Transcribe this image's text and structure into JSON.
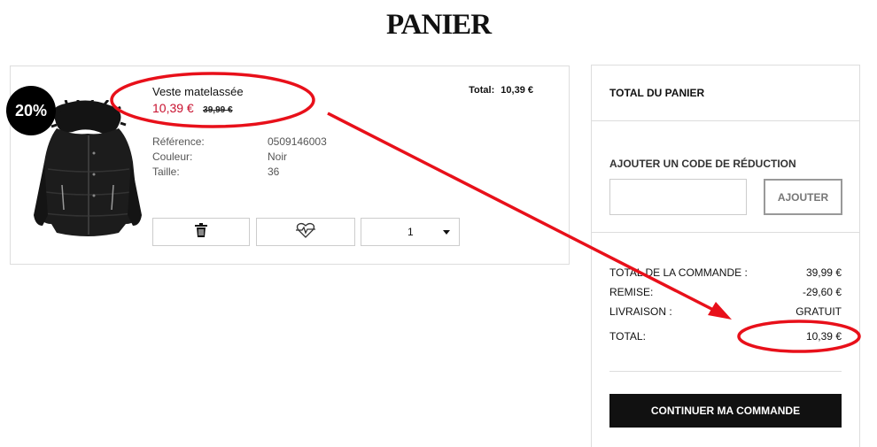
{
  "page": {
    "title": "PANIER"
  },
  "product": {
    "discount_badge": "20%",
    "name": "Veste matelassée",
    "price_current": "10,39 €",
    "price_old": "39,99 €",
    "total_label": "Total:",
    "total_value": "10,39 €",
    "specs": {
      "labels": [
        "Référence:",
        "Couleur:",
        "Taille:"
      ],
      "values": [
        "0509146003",
        "Noir",
        "36"
      ]
    },
    "actions": {
      "delete_icon": "trash-icon",
      "wishlist_icon": "heart-broken-icon",
      "quantity": "1"
    }
  },
  "summary": {
    "title": "TOTAL DU PANIER",
    "promo_label": "AJOUTER UN CODE DE RÉDUCTION",
    "promo_placeholder": "",
    "promo_button": "AJOUTER",
    "rows": [
      {
        "label": "TOTAL DE LA COMMANDE :",
        "value": "39,99 €"
      },
      {
        "label": "REMISE:",
        "value": "-29,60 €"
      },
      {
        "label": "LIVRAISON :",
        "value": "GRATUIT"
      },
      {
        "label": "TOTAL:",
        "value": "10,39 €"
      }
    ],
    "checkout_button": "CONTINUER MA COMMANDE"
  },
  "colors": {
    "sale_red": "#c8102e",
    "annotation_red": "#e8101a",
    "primary_dark": "#111111"
  }
}
